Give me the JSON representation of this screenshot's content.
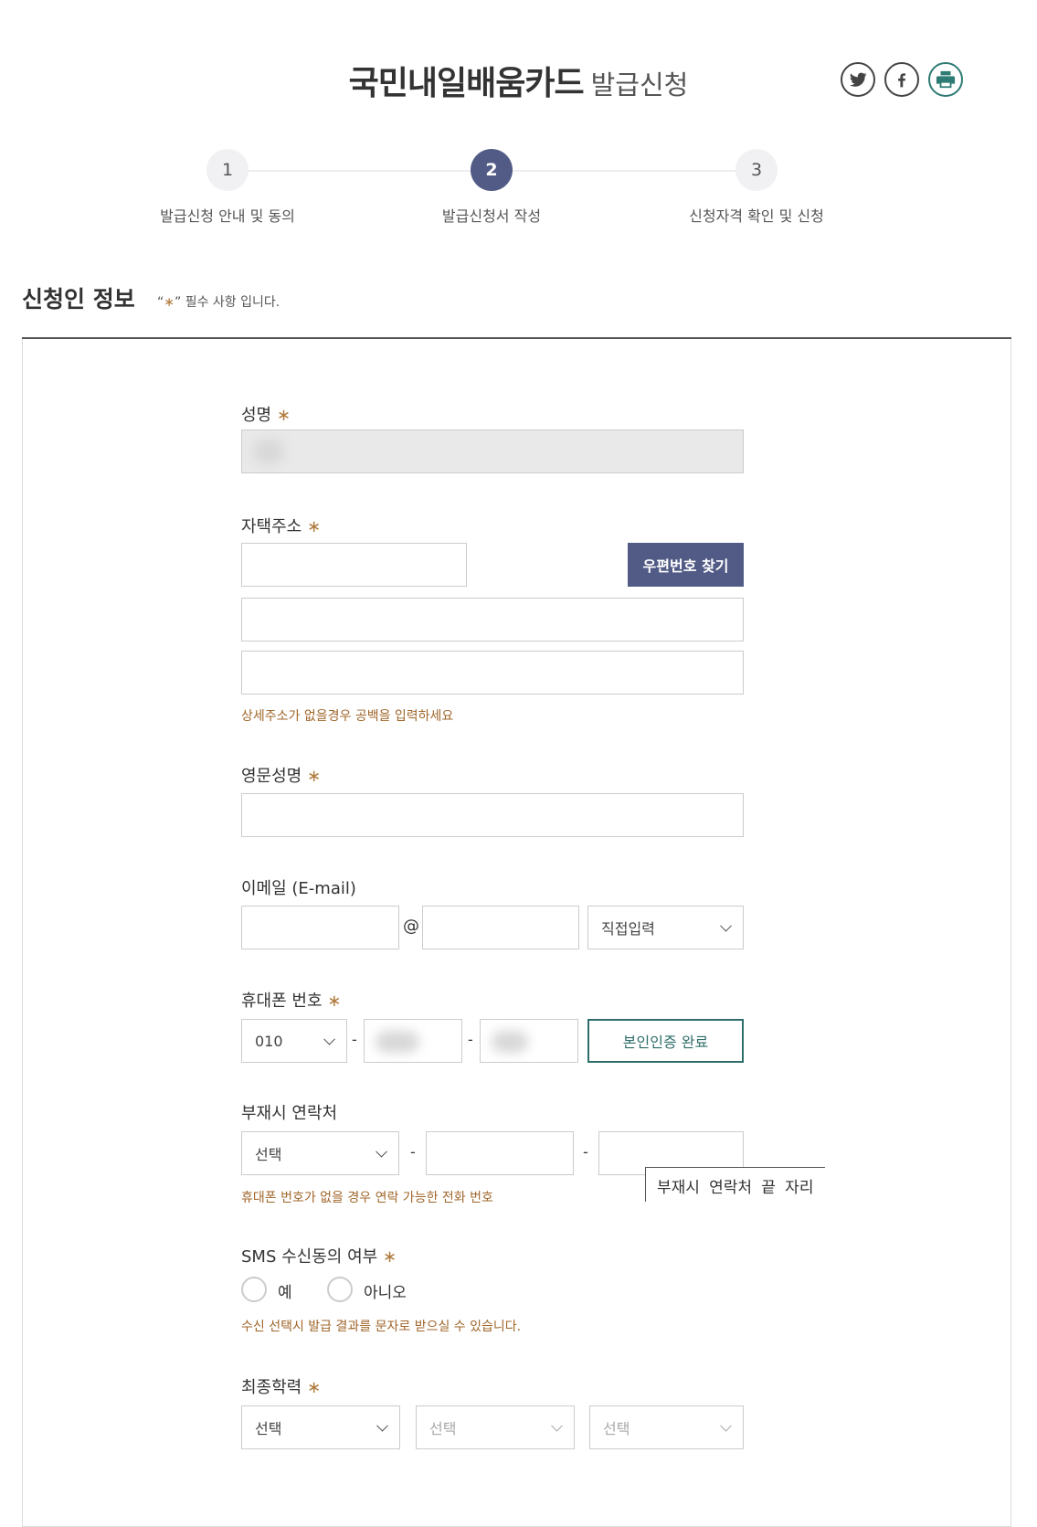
{
  "header": {
    "title_main": "국민내일배움카드",
    "title_sub": "발급신청",
    "share_icons": [
      "twitter-icon",
      "facebook-icon",
      "print-icon"
    ]
  },
  "steps": [
    {
      "number": "1",
      "label": "발급신청 안내 및 동의",
      "active": false
    },
    {
      "number": "2",
      "label": "발급신청서 작성",
      "active": true
    },
    {
      "number": "3",
      "label": "신청자격 확인 및 신청",
      "active": false
    }
  ],
  "section": {
    "title": "신청인 정보",
    "required_open": "“",
    "required_star": "∗",
    "required_close": "” 필수 사항 입니다."
  },
  "form": {
    "star": "∗",
    "name": {
      "label": "성명"
    },
    "address": {
      "label": "자택주소",
      "zip_button": "우편번호 찾기",
      "hint": "상세주소가 없을경우 공백을 입력하세요"
    },
    "english_name": {
      "label": "영문성명"
    },
    "email": {
      "label": "이메일 (E-mail)",
      "at": "@",
      "domain_select": "직접입력"
    },
    "mobile": {
      "label": "휴대폰 번호",
      "prefix": "010",
      "dash": "-",
      "verify_button": "본인인증 완료"
    },
    "alt_contact": {
      "label": "부재시 연락처",
      "select": "선택",
      "dash": "-",
      "hint": "휴대폰 번호가 없을 경우 연락 가능한 전화 번호",
      "tooltip": "부재시 연락처 끝 자리"
    },
    "sms": {
      "label": "SMS 수신동의 여부",
      "yes": "예",
      "no": "아니오",
      "hint": "수신 선택시 발급 결과를 문자로 받으실 수 있습니다."
    },
    "education": {
      "label": "최종학력",
      "select1": "선택",
      "select2": "선택",
      "select3": "선택"
    }
  },
  "colors": {
    "accent": "#525b86",
    "star": "#b07a3c",
    "hint": "#a0662a",
    "verify": "#2e6e6a"
  }
}
